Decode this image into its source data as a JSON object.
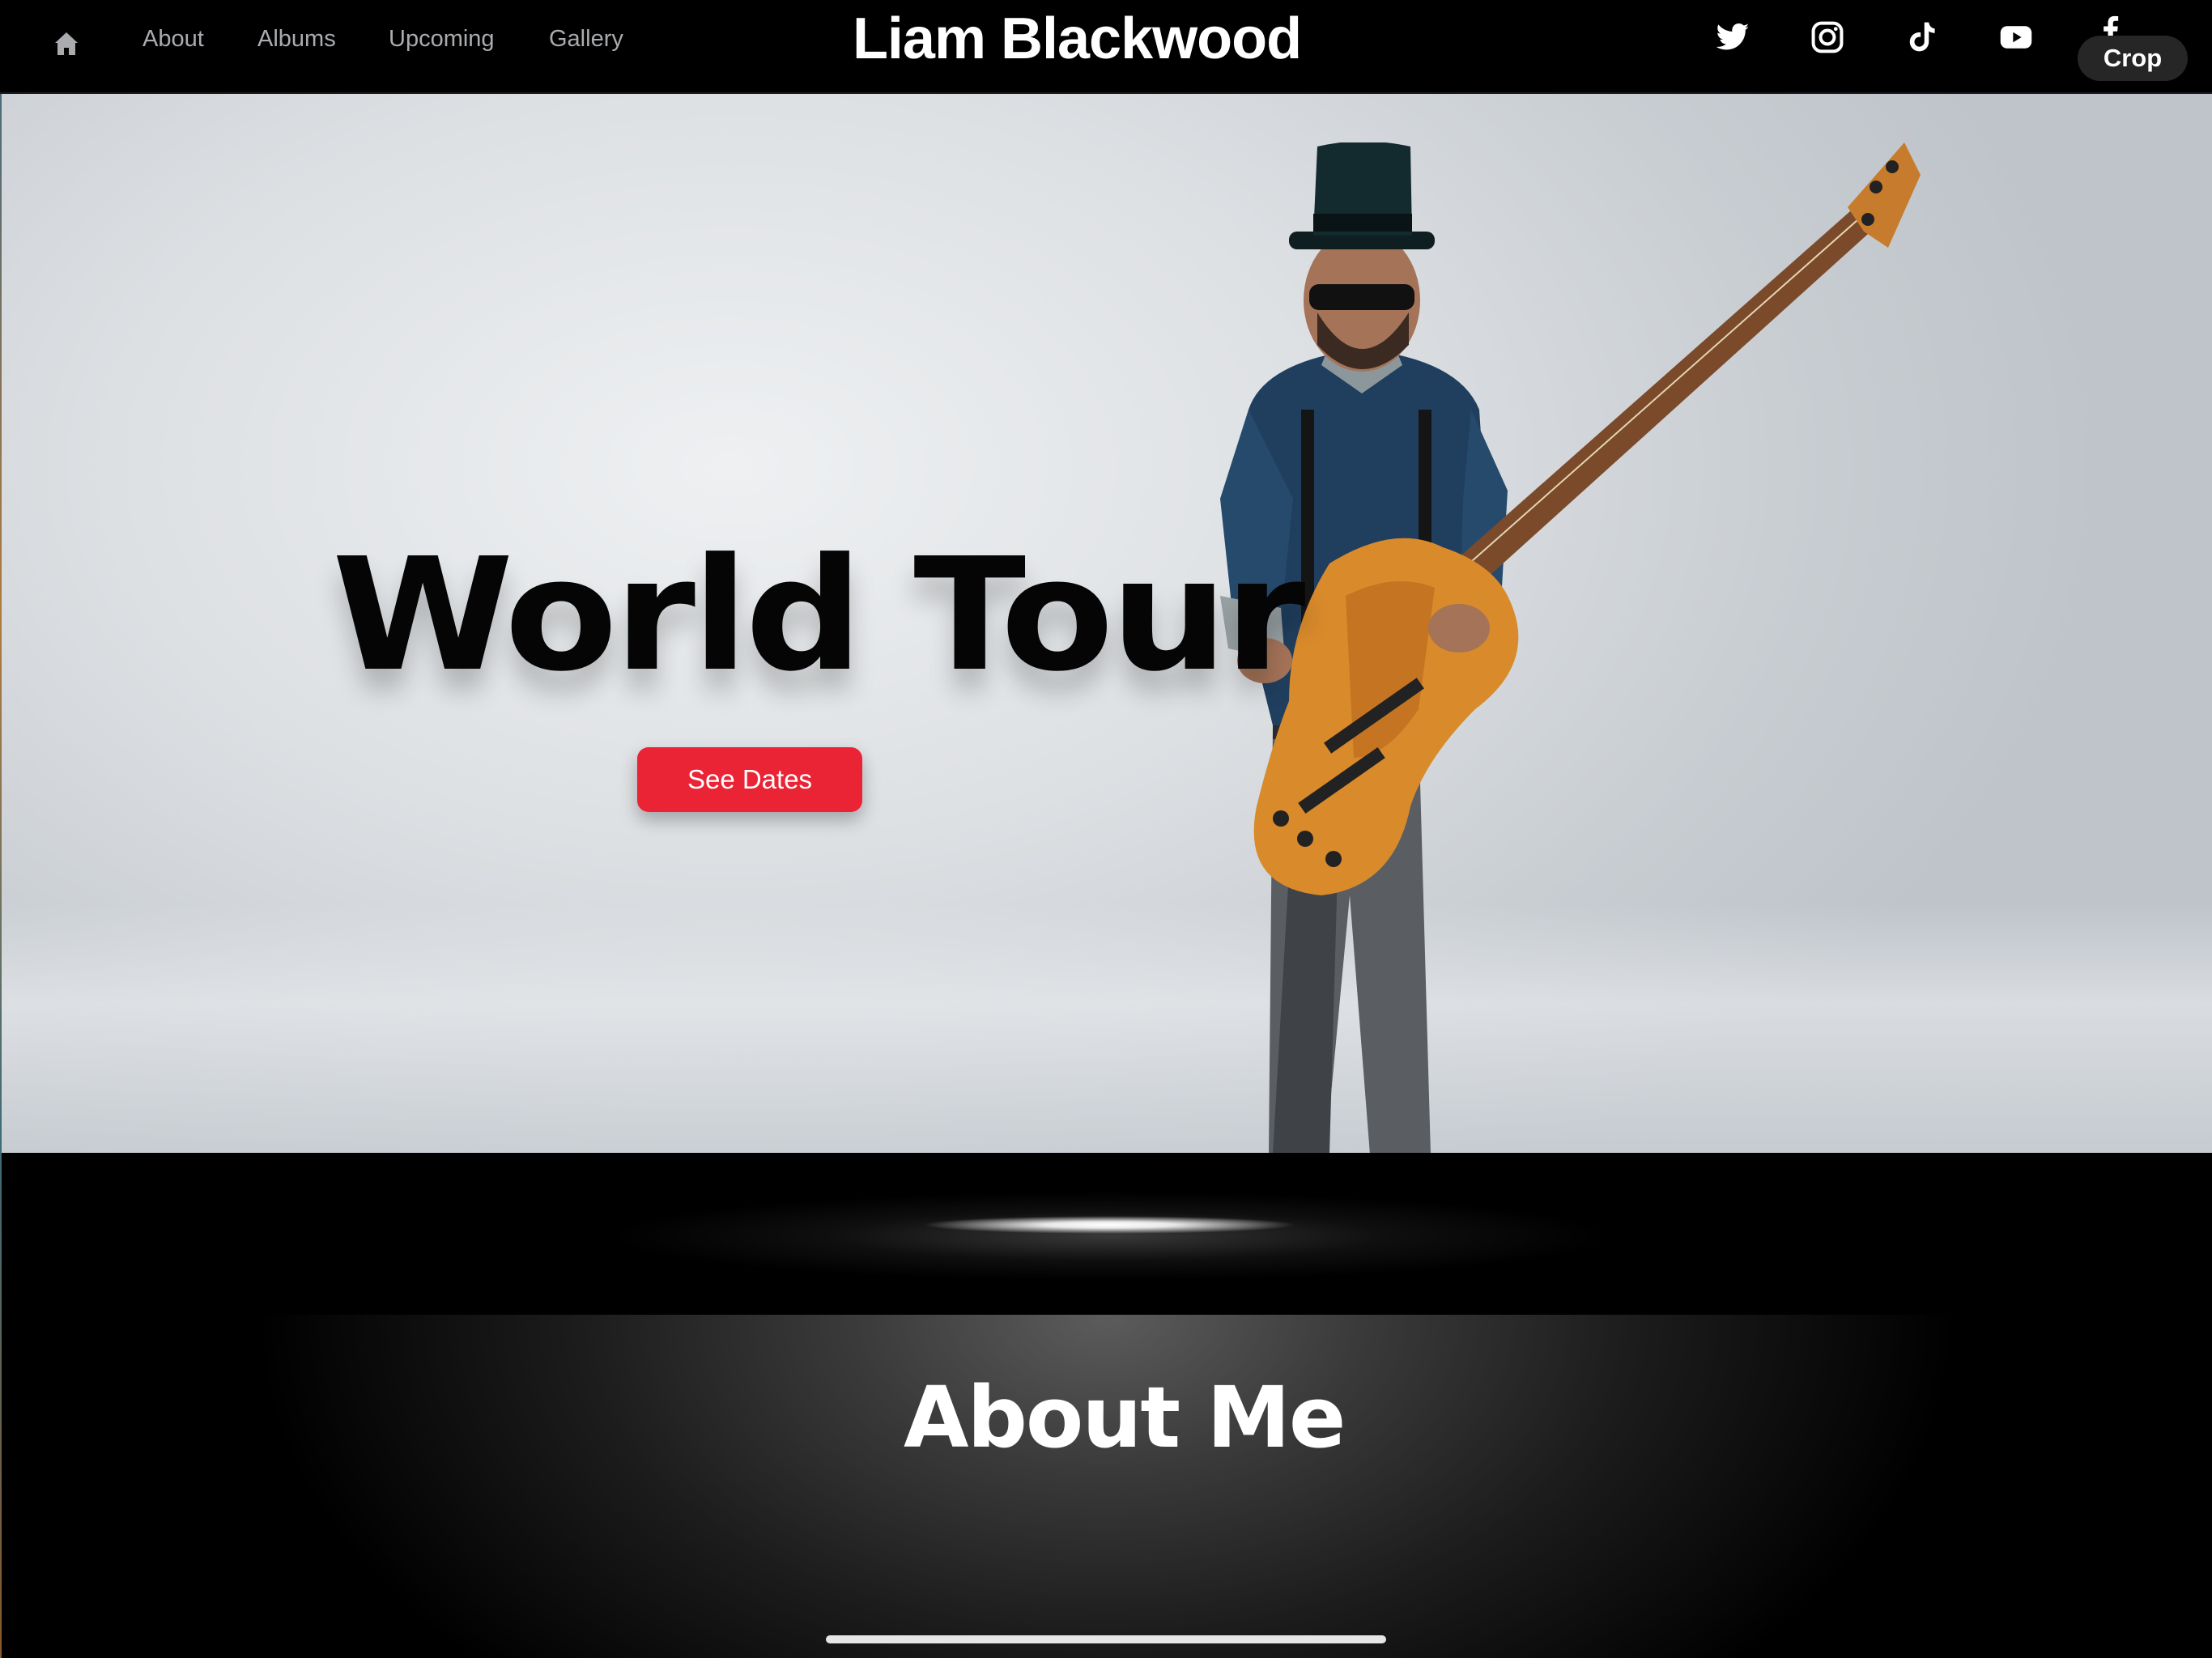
{
  "nav": {
    "home_icon": "home-icon",
    "links": [
      "About",
      "Albums",
      "Upcoming",
      "Gallery"
    ],
    "brand": "Liam Blackwood",
    "social_icons": [
      "twitter-icon",
      "instagram-icon",
      "tiktok-icon",
      "youtube-icon",
      "facebook-icon"
    ]
  },
  "overlay": {
    "crop_label": "Crop"
  },
  "hero": {
    "title": "World Tour",
    "cta_label": "See Dates",
    "accent_color": "#ea2434"
  },
  "about": {
    "title": "About Me"
  }
}
